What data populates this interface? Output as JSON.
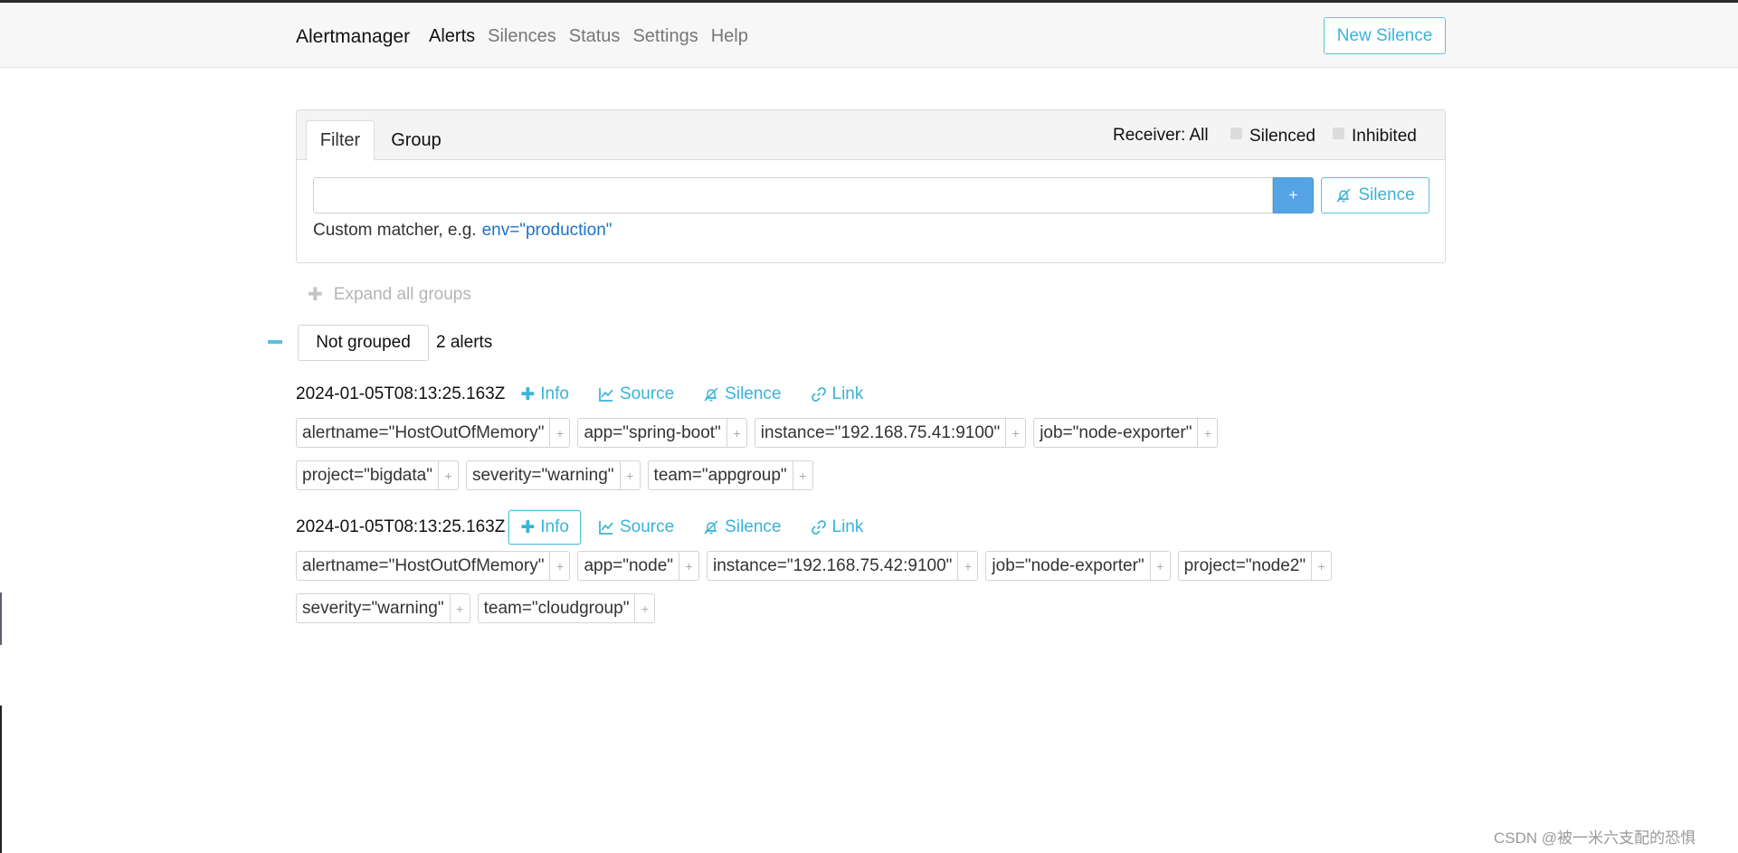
{
  "app": {
    "brand": "Alertmanager",
    "nav": [
      "Alerts",
      "Silences",
      "Status",
      "Settings",
      "Help"
    ],
    "new_silence_label": "New Silence"
  },
  "filter": {
    "tabs": [
      "Filter",
      "Group"
    ],
    "receiver_label": "Receiver: All",
    "silenced_label": "Silenced",
    "inhibited_label": "Inhibited",
    "input_value": "",
    "add_label": "+",
    "silence_label": "Silence",
    "hint_text": "Custom matcher, e.g.",
    "hint_code": "env=\"production\""
  },
  "expand_all_label": "Expand all groups",
  "group": {
    "name": "Not grouped",
    "count_label": "2 alerts"
  },
  "actions": {
    "info": "Info",
    "source": "Source",
    "silence": "Silence",
    "link": "Link"
  },
  "alerts": [
    {
      "timestamp": "2024-01-05T08:13:25.163Z",
      "labels": [
        "alertname=\"HostOutOfMemory\"",
        "app=\"spring-boot\"",
        "instance=\"192.168.75.41:9100\"",
        "job=\"node-exporter\"",
        "project=\"bigdata\"",
        "severity=\"warning\"",
        "team=\"appgroup\""
      ]
    },
    {
      "timestamp": "2024-01-05T08:13:25.163Z",
      "labels": [
        "alertname=\"HostOutOfMemory\"",
        "app=\"node\"",
        "instance=\"192.168.75.42:9100\"",
        "job=\"node-exporter\"",
        "project=\"node2\"",
        "severity=\"warning\"",
        "team=\"cloudgroup\""
      ]
    }
  ],
  "label_add_symbol": "+",
  "watermark": "CSDN @被一米六支配的恐惧"
}
